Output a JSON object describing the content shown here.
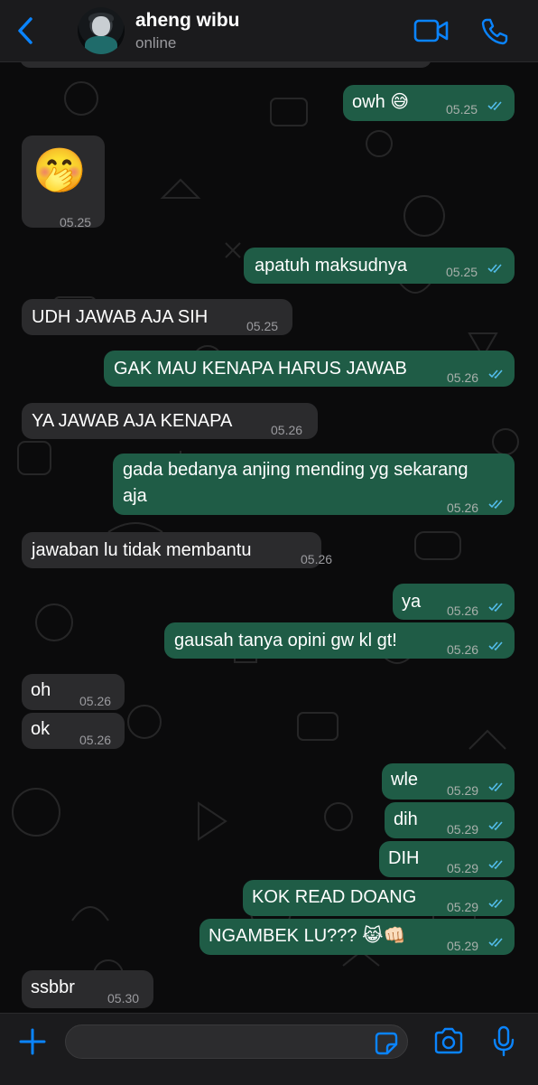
{
  "header": {
    "contact_name": "aheng wibu",
    "status": "online"
  },
  "messages": [
    {
      "text": "owh 😅",
      "time": "05.25",
      "dir": "out"
    },
    {
      "text": "🤭",
      "time": "05.25",
      "dir": "in",
      "emoji_only": true
    },
    {
      "text": "apatuh maksudnya",
      "time": "05.25",
      "dir": "out"
    },
    {
      "text": "UDH JAWAB AJA SIH",
      "time": "05.25",
      "dir": "in"
    },
    {
      "text": "GAK MAU KENAPA HARUS JAWAB",
      "time": "05.26",
      "dir": "out"
    },
    {
      "text": "YA JAWAB AJA KENAPA",
      "time": "05.26",
      "dir": "in"
    },
    {
      "text_line1": "gada bedanya anjing mending yg sekarang",
      "text_line2": "aja",
      "time": "05.26",
      "dir": "out"
    },
    {
      "text": "jawaban lu tidak membantu",
      "time": "05.26",
      "dir": "in"
    },
    {
      "text": "ya",
      "time": "05.26",
      "dir": "out"
    },
    {
      "text": "gausah tanya opini gw kl gt!",
      "time": "05.26",
      "dir": "out"
    },
    {
      "text": "oh",
      "time": "05.26",
      "dir": "in"
    },
    {
      "text": "ok",
      "time": "05.26",
      "dir": "in"
    },
    {
      "text": "wle",
      "time": "05.29",
      "dir": "out"
    },
    {
      "text": "dih",
      "time": "05.29",
      "dir": "out"
    },
    {
      "text": "DIH",
      "time": "05.29",
      "dir": "out"
    },
    {
      "text": "KOK READ DOANG",
      "time": "05.29",
      "dir": "out"
    },
    {
      "text": "NGAMBEK LU??? 😹👊🏻",
      "time": "05.29",
      "dir": "out"
    },
    {
      "text": "ssbbr",
      "time": "05.30",
      "dir": "in"
    }
  ],
  "icons": {
    "back": "chevron-left-icon",
    "video": "video-call-icon",
    "call": "phone-icon",
    "plus": "plus-icon",
    "sticker": "sticker-icon",
    "camera": "camera-icon",
    "mic": "microphone-icon"
  },
  "colors": {
    "accent": "#0a84ff",
    "outgoing_bubble": "#1f5c46",
    "incoming_bubble": "#2b2b2d",
    "read_ticks": "#53bdeb"
  }
}
